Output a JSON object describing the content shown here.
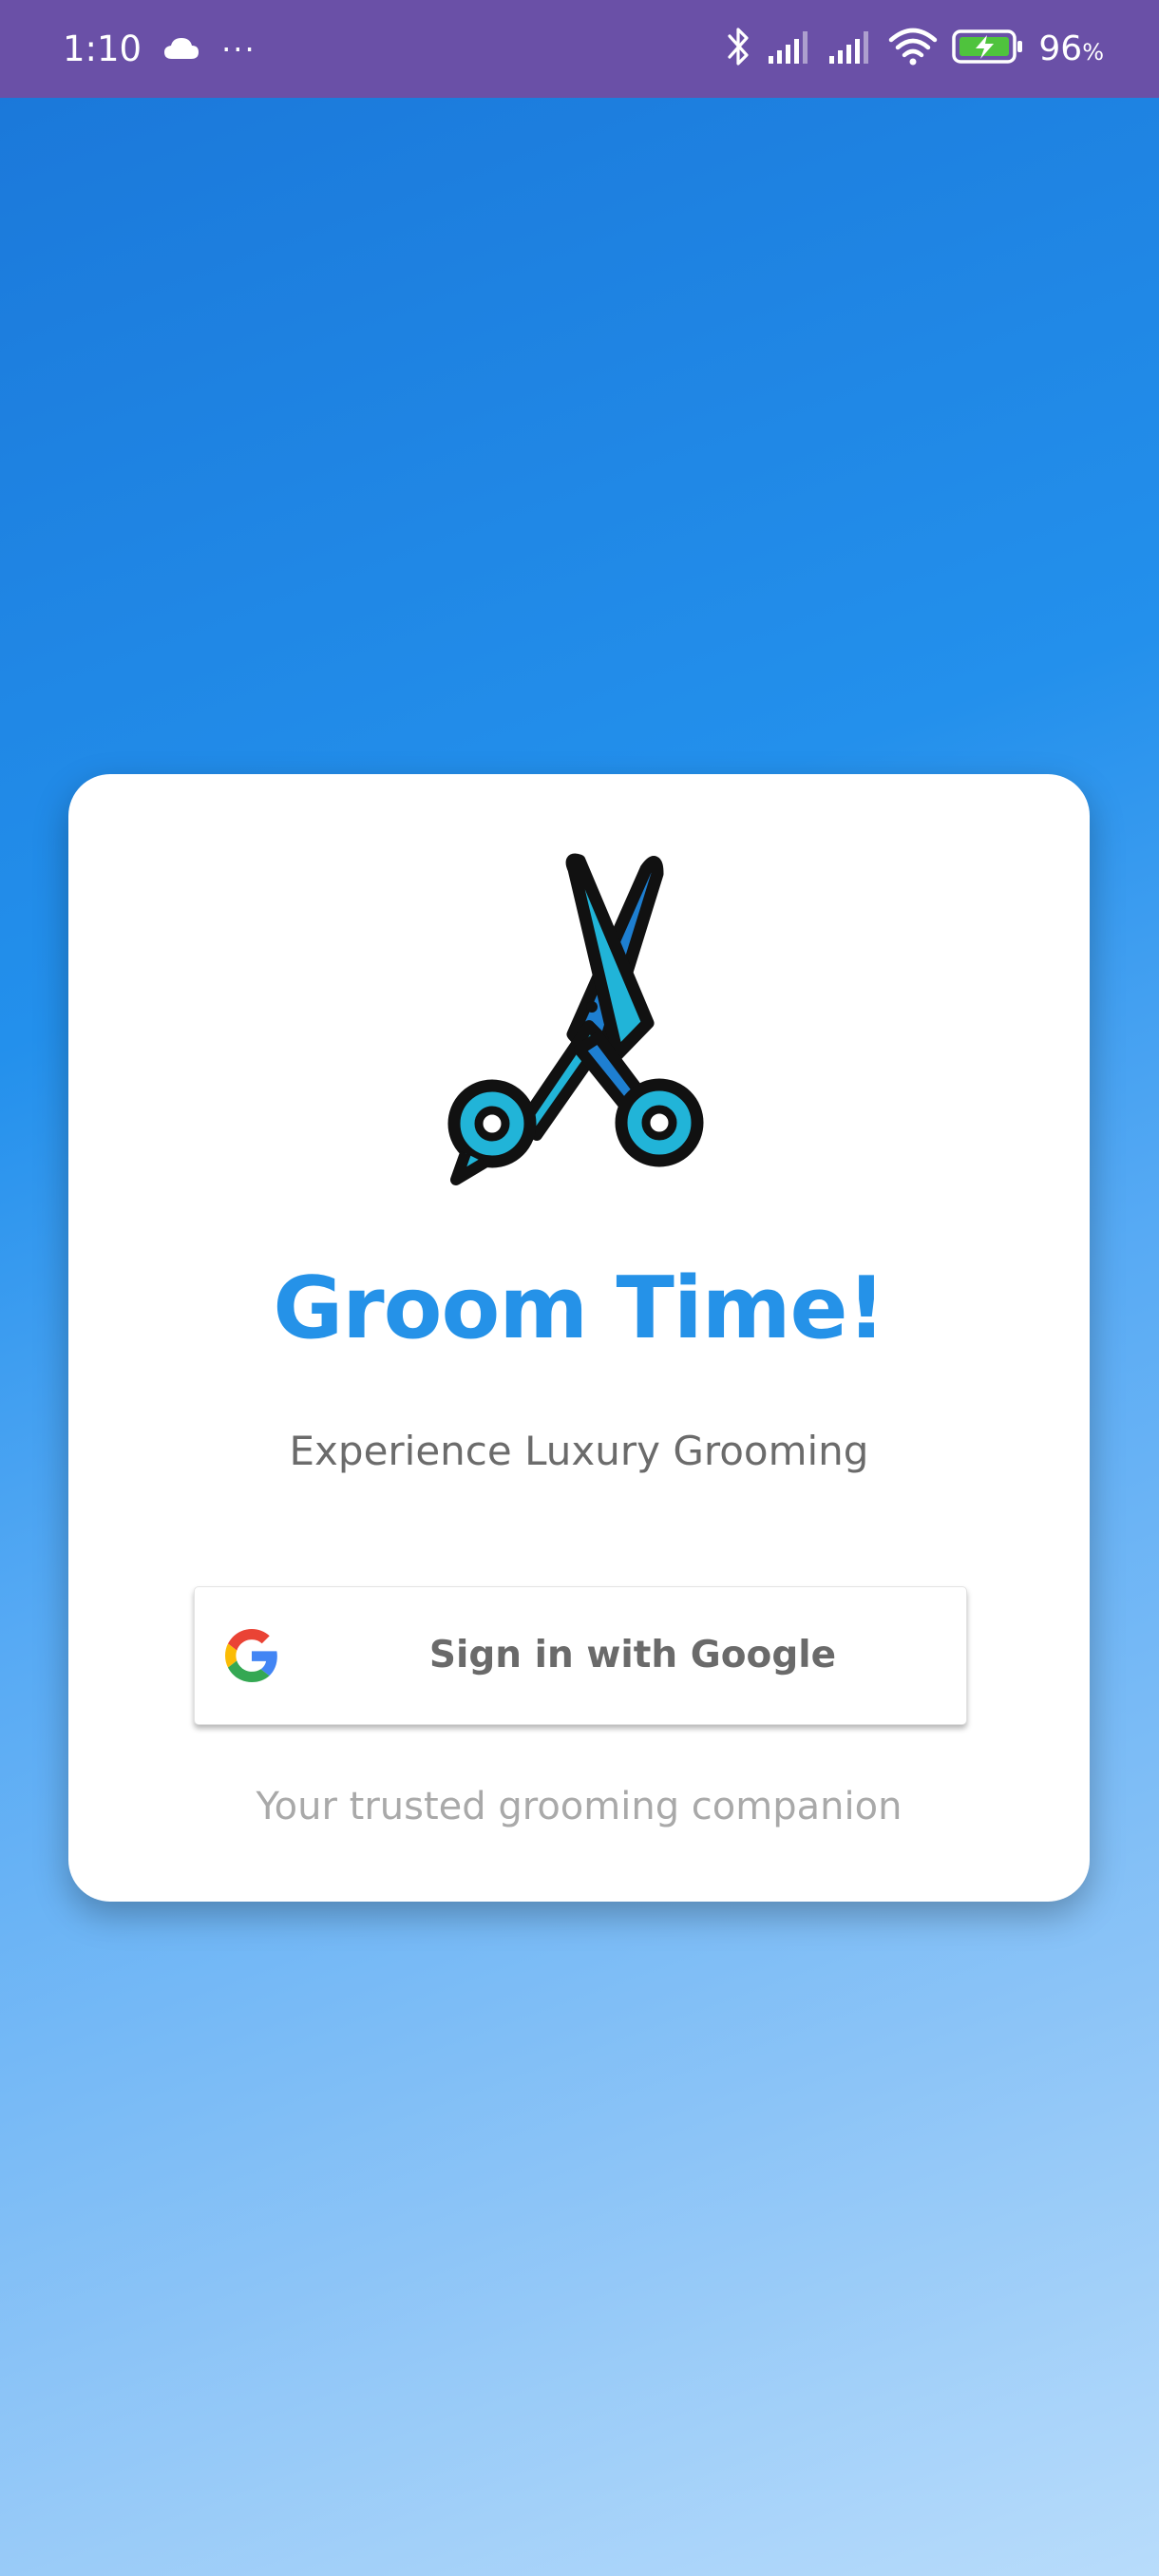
{
  "status_bar": {
    "time": "1:10",
    "more": "···",
    "battery_level": "96",
    "battery_unit": "%",
    "icons": [
      "cloud-icon",
      "bluetooth-icon",
      "signal-icon",
      "signal-icon",
      "wifi-icon",
      "battery-charging-icon"
    ]
  },
  "card": {
    "logo_icon": "scissors-icon",
    "title": "Groom Time!",
    "subtitle": "Experience Luxury Grooming",
    "google_button": {
      "label": "Sign in with Google",
      "icon": "google-g-icon"
    },
    "tagline": "Your trusted grooming companion"
  },
  "colors": {
    "status_bar": "#6a50a7",
    "title": "#2592e8",
    "gradient_top": "#1a76d8",
    "gradient_bottom": "#b8dcfb"
  }
}
